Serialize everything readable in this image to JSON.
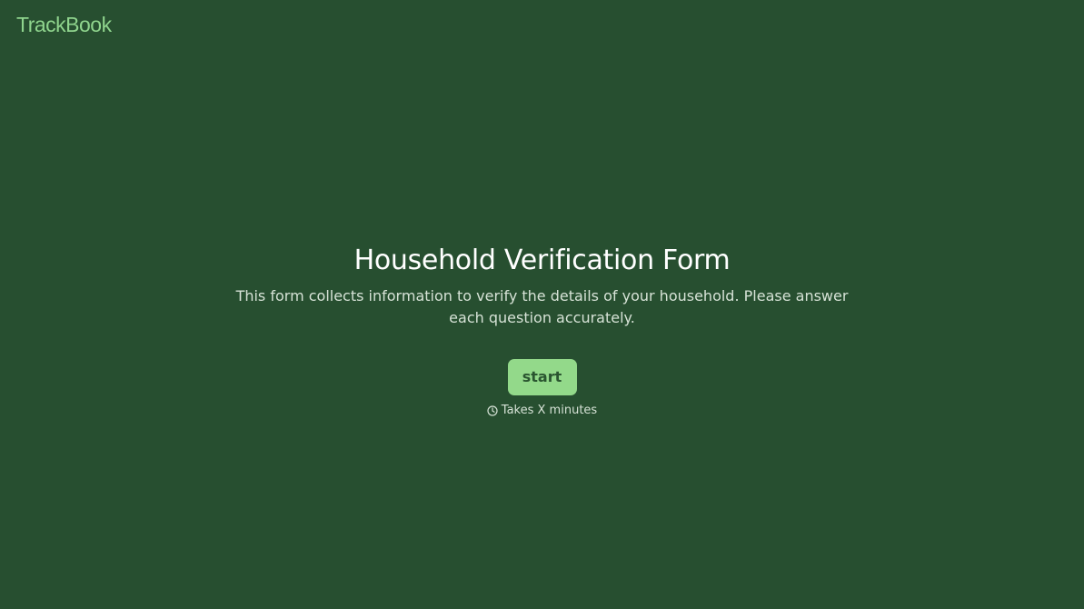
{
  "brand": {
    "name": "TrackBook",
    "color": "#8fd48d"
  },
  "theme": {
    "background": "#274f30",
    "button_bg": "#93d98a",
    "button_text": "#2a5530"
  },
  "intro": {
    "title": "Household Verification Form",
    "description": "This form collects information to verify the details of your household. Please answer each question accurately.",
    "start_label": "start",
    "duration_icon": "clock-icon",
    "duration_text": "Takes X minutes"
  }
}
